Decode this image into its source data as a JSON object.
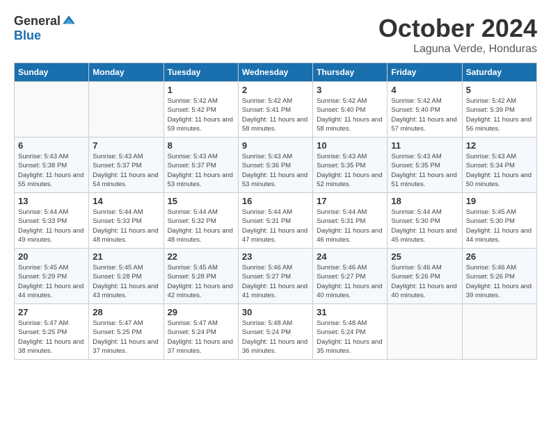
{
  "logo": {
    "general": "General",
    "blue": "Blue"
  },
  "title": "October 2024",
  "location": "Laguna Verde, Honduras",
  "days_of_week": [
    "Sunday",
    "Monday",
    "Tuesday",
    "Wednesday",
    "Thursday",
    "Friday",
    "Saturday"
  ],
  "weeks": [
    [
      {
        "day": "",
        "empty": true
      },
      {
        "day": "",
        "empty": true
      },
      {
        "day": "1",
        "sunrise": "5:42 AM",
        "sunset": "5:42 PM",
        "daylight": "11 hours and 59 minutes."
      },
      {
        "day": "2",
        "sunrise": "5:42 AM",
        "sunset": "5:41 PM",
        "daylight": "11 hours and 58 minutes."
      },
      {
        "day": "3",
        "sunrise": "5:42 AM",
        "sunset": "5:40 PM",
        "daylight": "11 hours and 58 minutes."
      },
      {
        "day": "4",
        "sunrise": "5:42 AM",
        "sunset": "5:40 PM",
        "daylight": "11 hours and 57 minutes."
      },
      {
        "day": "5",
        "sunrise": "5:42 AM",
        "sunset": "5:39 PM",
        "daylight": "11 hours and 56 minutes."
      }
    ],
    [
      {
        "day": "6",
        "sunrise": "5:43 AM",
        "sunset": "5:38 PM",
        "daylight": "11 hours and 55 minutes."
      },
      {
        "day": "7",
        "sunrise": "5:43 AM",
        "sunset": "5:37 PM",
        "daylight": "11 hours and 54 minutes."
      },
      {
        "day": "8",
        "sunrise": "5:43 AM",
        "sunset": "5:37 PM",
        "daylight": "11 hours and 53 minutes."
      },
      {
        "day": "9",
        "sunrise": "5:43 AM",
        "sunset": "5:36 PM",
        "daylight": "11 hours and 53 minutes."
      },
      {
        "day": "10",
        "sunrise": "5:43 AM",
        "sunset": "5:35 PM",
        "daylight": "11 hours and 52 minutes."
      },
      {
        "day": "11",
        "sunrise": "5:43 AM",
        "sunset": "5:35 PM",
        "daylight": "11 hours and 51 minutes."
      },
      {
        "day": "12",
        "sunrise": "5:43 AM",
        "sunset": "5:34 PM",
        "daylight": "11 hours and 50 minutes."
      }
    ],
    [
      {
        "day": "13",
        "sunrise": "5:44 AM",
        "sunset": "5:33 PM",
        "daylight": "11 hours and 49 minutes."
      },
      {
        "day": "14",
        "sunrise": "5:44 AM",
        "sunset": "5:33 PM",
        "daylight": "11 hours and 48 minutes."
      },
      {
        "day": "15",
        "sunrise": "5:44 AM",
        "sunset": "5:32 PM",
        "daylight": "11 hours and 48 minutes."
      },
      {
        "day": "16",
        "sunrise": "5:44 AM",
        "sunset": "5:31 PM",
        "daylight": "11 hours and 47 minutes."
      },
      {
        "day": "17",
        "sunrise": "5:44 AM",
        "sunset": "5:31 PM",
        "daylight": "11 hours and 46 minutes."
      },
      {
        "day": "18",
        "sunrise": "5:44 AM",
        "sunset": "5:30 PM",
        "daylight": "11 hours and 45 minutes."
      },
      {
        "day": "19",
        "sunrise": "5:45 AM",
        "sunset": "5:30 PM",
        "daylight": "11 hours and 44 minutes."
      }
    ],
    [
      {
        "day": "20",
        "sunrise": "5:45 AM",
        "sunset": "5:29 PM",
        "daylight": "11 hours and 44 minutes."
      },
      {
        "day": "21",
        "sunrise": "5:45 AM",
        "sunset": "5:28 PM",
        "daylight": "11 hours and 43 minutes."
      },
      {
        "day": "22",
        "sunrise": "5:45 AM",
        "sunset": "5:28 PM",
        "daylight": "11 hours and 42 minutes."
      },
      {
        "day": "23",
        "sunrise": "5:46 AM",
        "sunset": "5:27 PM",
        "daylight": "11 hours and 41 minutes."
      },
      {
        "day": "24",
        "sunrise": "5:46 AM",
        "sunset": "5:27 PM",
        "daylight": "11 hours and 40 minutes."
      },
      {
        "day": "25",
        "sunrise": "5:46 AM",
        "sunset": "5:26 PM",
        "daylight": "11 hours and 40 minutes."
      },
      {
        "day": "26",
        "sunrise": "5:46 AM",
        "sunset": "5:26 PM",
        "daylight": "11 hours and 39 minutes."
      }
    ],
    [
      {
        "day": "27",
        "sunrise": "5:47 AM",
        "sunset": "5:25 PM",
        "daylight": "11 hours and 38 minutes."
      },
      {
        "day": "28",
        "sunrise": "5:47 AM",
        "sunset": "5:25 PM",
        "daylight": "11 hours and 37 minutes."
      },
      {
        "day": "29",
        "sunrise": "5:47 AM",
        "sunset": "5:24 PM",
        "daylight": "11 hours and 37 minutes."
      },
      {
        "day": "30",
        "sunrise": "5:48 AM",
        "sunset": "5:24 PM",
        "daylight": "11 hours and 36 minutes."
      },
      {
        "day": "31",
        "sunrise": "5:48 AM",
        "sunset": "5:24 PM",
        "daylight": "11 hours and 35 minutes."
      },
      {
        "day": "",
        "empty": true
      },
      {
        "day": "",
        "empty": true
      }
    ]
  ]
}
